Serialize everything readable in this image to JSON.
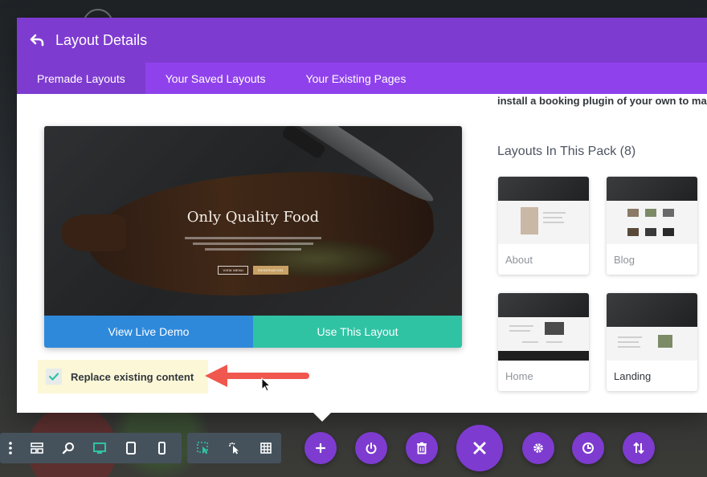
{
  "modal": {
    "title": "Layout Details",
    "tabs": [
      {
        "label": "Premade Layouts",
        "active": true
      },
      {
        "label": "Your Saved Layouts",
        "active": false
      },
      {
        "label": "Your Existing Pages",
        "active": false
      }
    ]
  },
  "preview": {
    "hero_title": "Only Quality Food",
    "hero_buttons": [
      "VIEW MENU",
      "RESERVATION"
    ],
    "view_demo_label": "View Live Demo",
    "use_layout_label": "Use This Layout"
  },
  "replace": {
    "label": "Replace existing content",
    "checked": true
  },
  "sidebar": {
    "description_line": "install a booking plugin of your own to mak",
    "pack_heading": "Layouts In This Pack (8)",
    "layouts": [
      {
        "label": "About"
      },
      {
        "label": "Blog"
      },
      {
        "label": "Home"
      },
      {
        "label": "Landing"
      }
    ]
  },
  "toolbar": {
    "icons": [
      "more-dots-icon",
      "wireframe-icon",
      "zoom-icon",
      "desktop-icon",
      "tablet-icon",
      "phone-icon",
      "hover-select-icon",
      "click-mode-icon",
      "grid-icon"
    ],
    "round_icons": [
      "add-icon",
      "power-icon",
      "trash-icon",
      "close-icon",
      "settings-icon",
      "history-icon",
      "sort-icon"
    ]
  },
  "colors": {
    "header": "#7e3bd0",
    "tabs": "#8f42ec",
    "demo_button": "#2e89db",
    "use_button": "#2fc3a4",
    "highlight": "#fbf7d7",
    "arrow": "#f0574e"
  }
}
